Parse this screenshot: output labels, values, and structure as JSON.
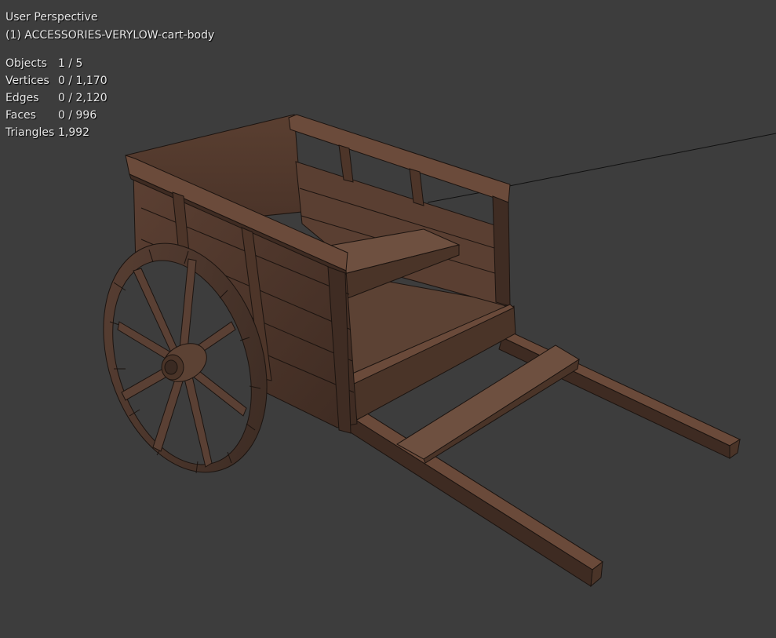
{
  "viewport": {
    "view_name": "User Perspective",
    "object_name": "(1) ACCESSORIES-VERYLOW-cart-body"
  },
  "stats": [
    {
      "label": "Objects",
      "value": "1 / 5"
    },
    {
      "label": "Vertices",
      "value": "0 / 1,170"
    },
    {
      "label": "Edges",
      "value": "0 / 2,120"
    },
    {
      "label": "Faces",
      "value": "0 / 996"
    },
    {
      "label": "Triangles",
      "value": "1,992"
    }
  ],
  "colors": {
    "background": "#3d3d3d",
    "wood_light": "#6e5040",
    "wood_mid": "#553b2f",
    "wood_dark": "#3b2a22",
    "wireframe": "#1a1a1a"
  },
  "model": {
    "name": "cart-body",
    "parts": [
      "cart-bed",
      "side-boards",
      "front-board",
      "seat-plank",
      "cross-plank",
      "shafts",
      "wheel"
    ]
  }
}
